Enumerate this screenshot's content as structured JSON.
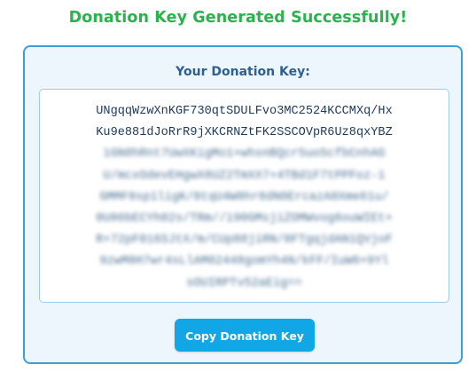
{
  "heading": "Donation Key Generated Successfully!",
  "panel": {
    "key_label": "Your Donation Key:",
    "key_lines": [
      "UNgqqWzwXnKGF730qtSDULFvo3MC2524KCCMXq/Hx",
      "Ku9e881dJoRrR9jXKCRNZtFK2SSCOVpR6Uz8qxYBZ",
      "1GN8hRnt7UwXKigMo1+whsnBQcr5uo5cfbCnhAG",
      "U/mcxOdevEHgwX8UZ2TmXX7+4TBd1F7tPPFoz-1",
      "GMMF8sp1ligK/0tqU4W8hr0dN0ErcazA8Xme61u/",
      "0U86bECYh02s/TRm//i90GMsjiZOMWvog6ouWIEt+",
      "R+72pF016SJtX/m/CUp88jiRN/8FTgqjdAN1QVjoF",
      "9zwM8H7wr4sLlAM02448gomYh4N/kFF/IuW6+9Yl",
      "sOUIRPTv52aEig=="
    ],
    "copy_button_label": "Copy Donation Key"
  },
  "colors": {
    "heading": "#2ab24f",
    "panel_border": "#3ba0d8",
    "panel_background": "#eef6fd",
    "button": "#11a6e6"
  }
}
